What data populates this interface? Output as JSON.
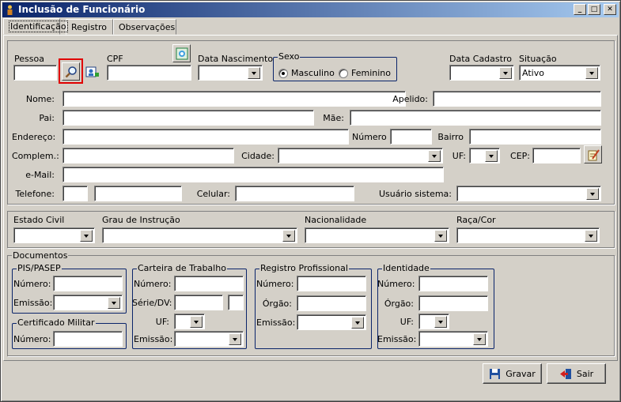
{
  "window": {
    "title": "Inclusão de Funcionário",
    "min": "_",
    "max": "□",
    "close": "✕"
  },
  "tabs": [
    {
      "label": "Identificação",
      "active": true
    },
    {
      "label": "Registro",
      "active": false
    },
    {
      "label": "Observações",
      "active": false
    }
  ],
  "ident": {
    "pessoa": "Pessoa",
    "cpf": "CPF",
    "data_nascimento": "Data Nascimento",
    "sexo": "Sexo",
    "masculino": "Masculino",
    "feminino": "Feminino",
    "sexo_selected": "Masculino",
    "data_cadastro": "Data Cadastro",
    "situacao": "Situação",
    "situacao_value": "Ativo",
    "nome": "Nome:",
    "apelido": "Apelido:",
    "pai": "Pai:",
    "mae": "Mãe:",
    "endereco": "Endereço:",
    "numero": "Número",
    "bairro": "Bairro",
    "complem": "Complem.:",
    "cidade": "Cidade:",
    "uf": "UF:",
    "cep": "CEP:",
    "email": "e-Mail:",
    "telefone": "Telefone:",
    "celular": "Celular:",
    "usuario_sistema": "Usuário sistema:"
  },
  "civil": {
    "estado_civil": "Estado Civil",
    "grau_instrucao": "Grau de Instrução",
    "nacionalidade": "Nacionalidade",
    "raca_cor": "Raça/Cor"
  },
  "docs": {
    "title": "Documentos",
    "pis": {
      "title": "PIS/PASEP",
      "numero": "Número:",
      "emissao": "Emissão:"
    },
    "militar": {
      "title": "Certificado Militar",
      "numero": "Número:"
    },
    "carteira": {
      "title": "Carteira de Trabalho",
      "numero": "Número:",
      "serie": "Série/DV:",
      "uf": "UF:",
      "emissao": "Emissão:"
    },
    "registro": {
      "title": "Registro Profissional",
      "numero": "Número:",
      "orgao": "Órgão:",
      "emissao": "Emissão:"
    },
    "identidade": {
      "title": "Identidade",
      "numero": "Número:",
      "orgao": "Órgão:",
      "uf": "UF:",
      "emissao": "Emissão:"
    }
  },
  "buttons": {
    "gravar": "Gravar",
    "sair": "Sair"
  },
  "icons": [
    "app-icon",
    "search-icon",
    "person-card-icon",
    "photo-icon",
    "edit-note-icon",
    "floppy-disk-icon",
    "exit-door-icon"
  ]
}
